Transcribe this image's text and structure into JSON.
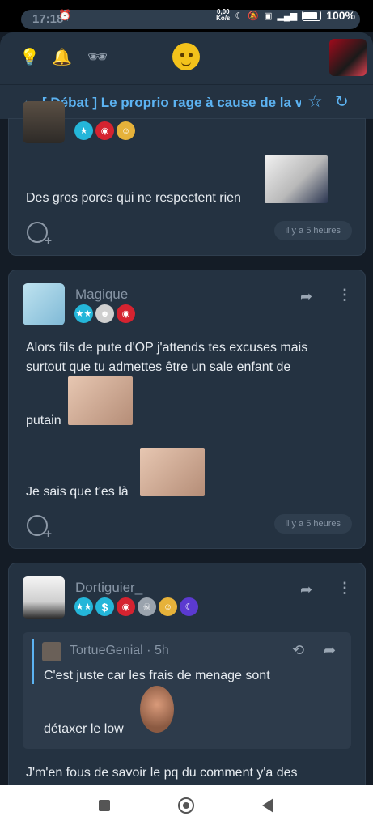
{
  "status": {
    "time": "17:18",
    "netspeed_top": "0,00",
    "netspeed_unit": "Ko/s",
    "battery": "100%"
  },
  "title": {
    "text": "[ Débat ] Le proprio rage à cause de la vai"
  },
  "posts": [
    {
      "text": "Des gros porcs qui ne respectent rien",
      "time": "il y a 5 heures"
    },
    {
      "username": "Magique",
      "line1": "Alors fils de pute d'OP j'attends tes excuses mais",
      "line2": "surtout que tu admettes être un sale enfant de",
      "line3": "putain",
      "line4": "Je sais que t'es là",
      "time": "il y a 5 heures"
    },
    {
      "username": "Dortiguier_",
      "quote_author": "TortueGenial",
      "quote_time": "· 5h",
      "quote_line1": "C'est juste car les frais de menage sont",
      "quote_line2": "détaxer le low",
      "text": "J'm'en fous de savoir le pq du comment y'a des"
    }
  ]
}
